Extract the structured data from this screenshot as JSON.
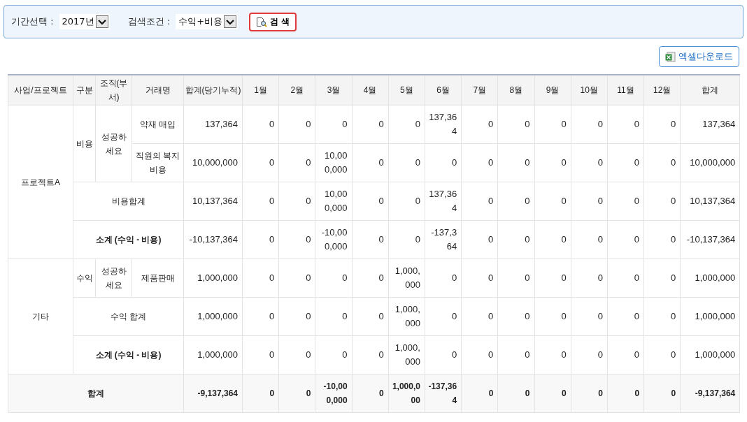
{
  "filter_bar": {
    "period": {
      "label": "기간선택 :",
      "value": "2017년"
    },
    "condition": {
      "label": "검색조건 :",
      "value": "수익+비용"
    },
    "search_button": "검 색"
  },
  "excel_button": "엑셀다운로드",
  "table": {
    "columns": [
      "사업/프로젝트",
      "구분",
      "조직(부서)",
      "거래명",
      "합계(당기누적)",
      "1월",
      "2월",
      "3월",
      "4월",
      "5월",
      "6월",
      "7월",
      "8월",
      "9월",
      "10월",
      "11월",
      "12월",
      "합계"
    ],
    "groups": [
      {
        "name": "프로젝트A",
        "categories": [
          {
            "type": "비용",
            "org": "성공하세요",
            "items": [
              {
                "name": "약재 매입",
                "values": [
                  "137,364",
                  "0",
                  "0",
                  "0",
                  "0",
                  "0",
                  "137,364",
                  "0",
                  "0",
                  "0",
                  "0",
                  "0",
                  "0",
                  "137,364"
                ]
              },
              {
                "name": "직원의 복지 비용",
                "values": [
                  "10,000,000",
                  "0",
                  "0",
                  "10,000,000",
                  "0",
                  "0",
                  "0",
                  "0",
                  "0",
                  "0",
                  "0",
                  "0",
                  "0",
                  "10,000,000"
                ]
              }
            ]
          }
        ],
        "subtotals": [
          {
            "label": "비용합계",
            "kind": "sum",
            "values": [
              "10,137,364",
              "0",
              "0",
              "10,000,000",
              "0",
              "0",
              "137,364",
              "0",
              "0",
              "0",
              "0",
              "0",
              "0",
              "10,137,364"
            ]
          },
          {
            "label": "소계 (수익 - 비용)",
            "kind": "subtotal",
            "values": [
              "-10,137,364",
              "0",
              "0",
              "-10,000,000",
              "0",
              "0",
              "-137,364",
              "0",
              "0",
              "0",
              "0",
              "0",
              "0",
              "-10,137,364"
            ]
          }
        ]
      },
      {
        "name": "기타",
        "categories": [
          {
            "type": "수익",
            "org": "성공하세요",
            "items": [
              {
                "name": "제품판매",
                "values": [
                  "1,000,000",
                  "0",
                  "0",
                  "0",
                  "0",
                  "1,000,000",
                  "0",
                  "0",
                  "0",
                  "0",
                  "0",
                  "0",
                  "0",
                  "1,000,000"
                ]
              }
            ]
          }
        ],
        "subtotals": [
          {
            "label": "수익 합계",
            "kind": "sum",
            "values": [
              "1,000,000",
              "0",
              "0",
              "0",
              "0",
              "1,000,000",
              "0",
              "0",
              "0",
              "0",
              "0",
              "0",
              "0",
              "1,000,000"
            ]
          },
          {
            "label": "소계 (수익 - 비용)",
            "kind": "subtotal",
            "values": [
              "1,000,000",
              "0",
              "0",
              "0",
              "0",
              "1,000,000",
              "0",
              "0",
              "0",
              "0",
              "0",
              "0",
              "0",
              "1,000,000"
            ]
          }
        ]
      }
    ],
    "grand_total": {
      "label": "합계",
      "values": [
        "-9,137,364",
        "0",
        "0",
        "-10,000,000",
        "0",
        "1,000,000",
        "-137,364",
        "0",
        "0",
        "0",
        "0",
        "0",
        "0",
        "-9,137,364"
      ]
    }
  }
}
